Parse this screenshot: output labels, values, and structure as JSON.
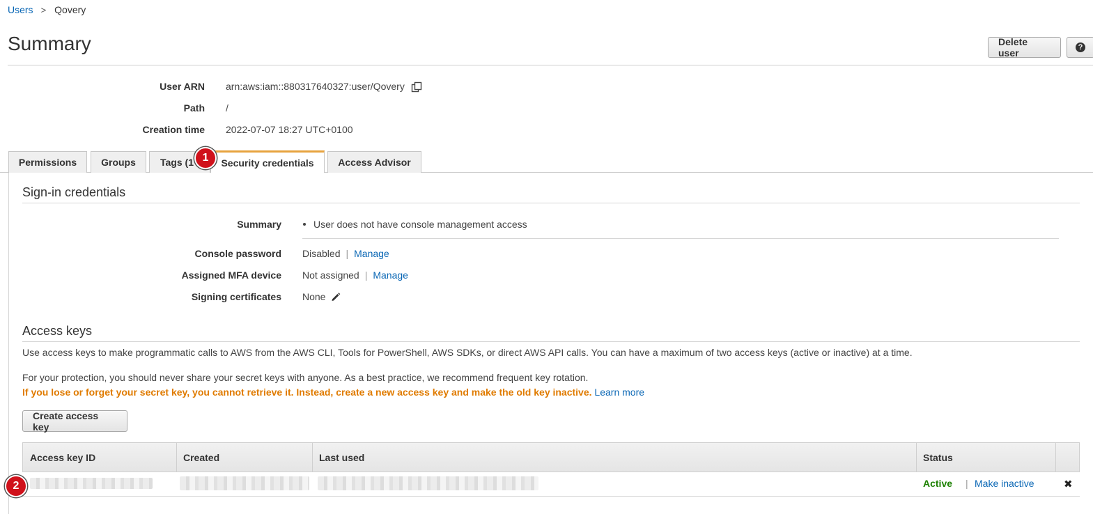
{
  "breadcrumb": {
    "parent": "Users",
    "separator": ">",
    "current": "Qovery"
  },
  "page": {
    "title": "Summary"
  },
  "toolbar": {
    "delete_label": "Delete user",
    "help_label": "?"
  },
  "summary": {
    "arn_label": "User ARN",
    "arn_value": "arn:aws:iam::880317640327:user/Qovery",
    "path_label": "Path",
    "path_value": "/",
    "creation_label": "Creation time",
    "creation_value": "2022-07-07 18:27 UTC+0100"
  },
  "tabs": [
    {
      "label": "Permissions"
    },
    {
      "label": "Groups"
    },
    {
      "label": "Tags (1"
    },
    {
      "label": "Security credentials",
      "active": true
    },
    {
      "label": "Access Advisor"
    }
  ],
  "signin": {
    "title": "Sign-in credentials",
    "summary_label": "Summary",
    "summary_value": "User does not have console management access",
    "console_label": "Console password",
    "console_value": "Disabled",
    "console_link": "Manage",
    "mfa_label": "Assigned MFA device",
    "mfa_value": "Not assigned",
    "mfa_link": "Manage",
    "signing_label": "Signing certificates",
    "signing_value": "None"
  },
  "access_keys": {
    "title": "Access keys",
    "intro": "Use access keys to make programmatic calls to AWS from the AWS CLI, Tools for PowerShell, AWS SDKs, or direct AWS API calls. You can have a maximum of two access keys (active or inactive) at a time.",
    "protection": "For your protection, you should never share your secret keys with anyone. As a best practice, we recommend frequent key rotation.",
    "warning": "If you lose or forget your secret key, you cannot retrieve it. Instead, create a new access key and make the old key inactive.",
    "learn_more": "Learn more",
    "create_label": "Create access key",
    "columns": [
      "Access key ID",
      "Created",
      "Last used",
      "Status"
    ],
    "row": {
      "status": "Active",
      "action": "Make inactive",
      "delete": "✖"
    }
  },
  "annotations": {
    "marker1": "1",
    "marker2": "2"
  },
  "colors": {
    "link": "#0a67b5",
    "warning": "#e07b00",
    "active": "#1d8102",
    "tab_accent": "#e7a33e",
    "marker": "#d0111b"
  },
  "icons": [
    "copy-icon",
    "pencil-icon",
    "help-icon",
    "delete-icon"
  ]
}
